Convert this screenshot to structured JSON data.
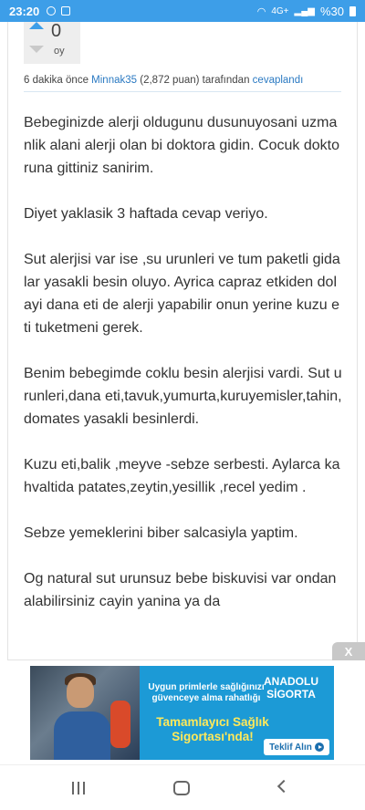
{
  "status_bar": {
    "time": "23:20",
    "battery": "%30",
    "network": "4G+"
  },
  "vote": {
    "score": "0",
    "unit": "oy"
  },
  "meta": {
    "prefix": "6 dakika önce",
    "user": "Minnak35",
    "points": "(2,872 puan)",
    "middle": "tarafından",
    "action": "cevaplandı"
  },
  "answer": {
    "paragraphs": [
      "Bebeginizde alerji oldugunu dusunuyosani uzmanlik alani alerji olan bi doktora gidin. Cocuk doktoruna gittiniz sanirim.",
      "Diyet yaklasik 3 haftada cevap veriyo.",
      "Sut alerjisi var ise ,su urunleri ve tum paketli gidalar yasakli besin oluyo. Ayrica capraz etkiden dolayi dana eti de alerji yapabilir onun yerine kuzu eti tuketmeni gerek.",
      "Benim bebegimde coklu besin alerjisi vardi. Sut urunleri,dana eti,tavuk,yumurta,kuruyemisler,tahin,domates yasakli besinlerdi.",
      "Kuzu eti,balik ,meyve -sebze serbesti. Aylarca kahvaltida patates,zeytin,yesillik ,recel yedim .",
      "Sebze yemeklerini biber salcasiyla yaptim.",
      "Og natural sut urunsuz bebe biskuvisi var ondan alabilirsiniz cayin yanina ya da"
    ]
  },
  "ad": {
    "close_label": "X",
    "brand_line1": "ANADOLU",
    "brand_line2": "SİGORTA",
    "line1": "Uygun primlerle sağlığınızı güvenceye alma rahatlığı",
    "line2": "Tamamlayıcı Sağlık Sigortası'nda!",
    "cta": "Teklif Alın"
  }
}
